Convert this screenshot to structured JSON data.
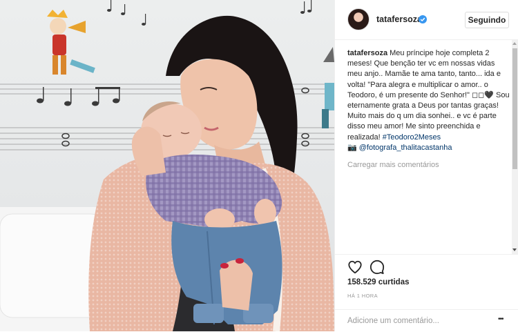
{
  "post": {
    "username": "tatafersoza",
    "follow_label": "Seguindo",
    "caption_user": "tatafersoza",
    "caption_text": " Meu príncipe hoje completa 2 meses! Que benção ter vc em nossas vidas meu anjo.. Mamãe te ama tanto, tanto... ida e volta! \"Para alegra e multiplicar o amor.. o Teodoro, é um presente do Senhor!\" ◻◻🖤 Sou eternamente grata a Deus por tantas graças! Muito mais do q um dia sonhei.. e vc é parte disso meu amor! Me sinto preenchida e realizada! ",
    "hashtag": "#Teodoro2Meses",
    "camera_glyph": "📷",
    "mention": "@fotografa_thalitacastanha",
    "load_more": "Carregar mais comentários",
    "likes": "158.529 curtidas",
    "time": "HÁ 1 HORA",
    "comment_placeholder": "Adicione um comentário...",
    "more_glyph": "•••"
  },
  "colors": {
    "link": "#003569",
    "verified": "#3897f0",
    "muted": "#999999",
    "text": "#262626"
  },
  "icons": [
    "verified-badge-icon",
    "heart-icon",
    "comment-icon",
    "more-options-icon",
    "camera-icon"
  ]
}
